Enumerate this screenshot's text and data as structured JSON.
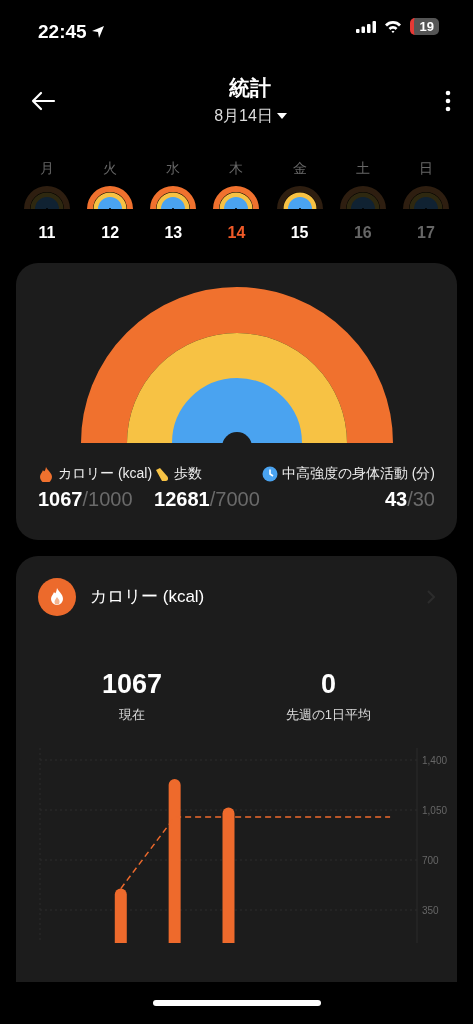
{
  "status_bar": {
    "time": "22:45",
    "battery": "19"
  },
  "header": {
    "title": "統計",
    "date": "8月14日"
  },
  "week": [
    {
      "weekday": "月",
      "date": "11",
      "selected": false,
      "disabled": false,
      "rings": [
        {
          "done": false
        },
        {
          "done": false
        },
        {
          "done": false
        }
      ]
    },
    {
      "weekday": "火",
      "date": "12",
      "selected": false,
      "disabled": false,
      "rings": [
        {
          "done": true
        },
        {
          "done": true
        },
        {
          "done": true
        }
      ]
    },
    {
      "weekday": "水",
      "date": "13",
      "selected": false,
      "disabled": false,
      "rings": [
        {
          "done": true
        },
        {
          "done": true
        },
        {
          "done": true
        }
      ]
    },
    {
      "weekday": "木",
      "date": "14",
      "selected": true,
      "disabled": false,
      "rings": [
        {
          "done": true
        },
        {
          "done": true
        },
        {
          "done": true
        }
      ]
    },
    {
      "weekday": "金",
      "date": "15",
      "selected": false,
      "disabled": false,
      "rings": [
        {
          "done": false
        },
        {
          "done": true
        },
        {
          "done": true
        }
      ]
    },
    {
      "weekday": "土",
      "date": "16",
      "selected": false,
      "disabled": true,
      "rings": [
        {
          "done": false
        },
        {
          "done": false
        },
        {
          "done": false
        }
      ]
    },
    {
      "weekday": "日",
      "date": "17",
      "selected": false,
      "disabled": true,
      "rings": [
        {
          "done": false
        },
        {
          "done": false
        },
        {
          "done": false
        }
      ]
    }
  ],
  "summary": {
    "metrics": [
      {
        "kind": "calories",
        "label": "カロリー (kcal)",
        "value": "1067",
        "goal": "/1000"
      },
      {
        "kind": "steps",
        "label": "歩数",
        "value": "12681",
        "goal": "/7000"
      },
      {
        "kind": "activity",
        "label": "中高強度の身体活動 (分)",
        "value": "43",
        "goal": "/30"
      }
    ]
  },
  "calorie_card": {
    "title": "カロリー (kcal)",
    "stats": [
      {
        "value": "1067",
        "label": "現在"
      },
      {
        "value": "0",
        "label": "先週の1日平均"
      }
    ],
    "chart_data": {
      "type": "bar",
      "ylim": [
        119,
        1400
      ],
      "yticks": [
        {
          "value": 350,
          "label": "350"
        },
        {
          "value": 700,
          "label": "700"
        },
        {
          "value": 1050,
          "label": "1,050"
        },
        {
          "value": 1400,
          "label": "1,400"
        }
      ],
      "grid": true,
      "series": [
        {
          "type": "bar",
          "values": [
            null,
            500,
            1267,
            1067,
            null,
            null,
            null
          ]
        },
        {
          "type": "line",
          "line_style": "dashed",
          "values": [
            null,
            500,
            1000,
            1000,
            1000,
            1000,
            1000
          ]
        }
      ]
    }
  }
}
